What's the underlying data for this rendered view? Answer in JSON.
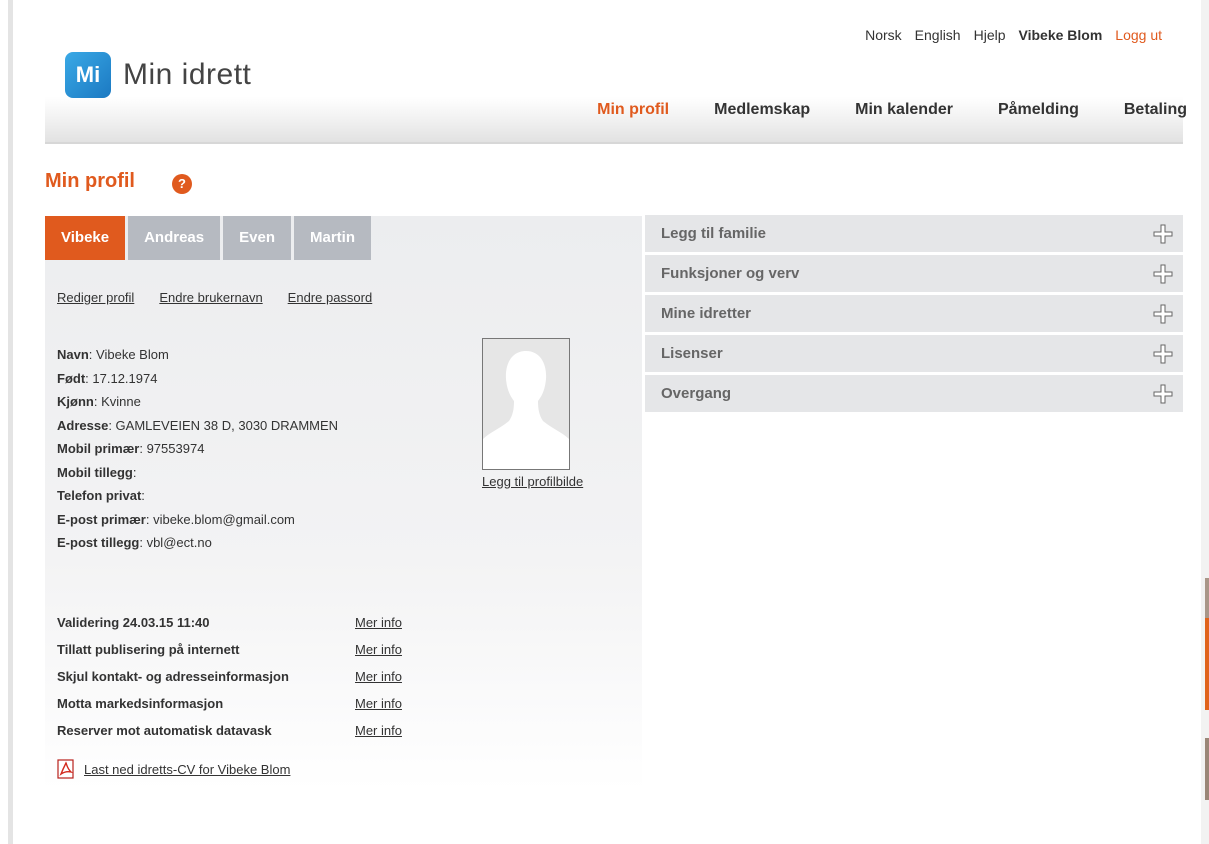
{
  "topnav": {
    "norsk": "Norsk",
    "english": "English",
    "help": "Hjelp",
    "user": "Vibeke Blom",
    "logout": "Logg ut"
  },
  "logo": {
    "badge": "Mi",
    "text": "Min idrett"
  },
  "mainnav": [
    "Min profil",
    "Medlemskap",
    "Min kalender",
    "Påmelding",
    "Betaling"
  ],
  "page": {
    "title": "Min profil",
    "help_icon": "?"
  },
  "tabs": [
    "Vibeke",
    "Andreas",
    "Even",
    "Martin"
  ],
  "actions": [
    "Rediger profil",
    "Endre brukernavn",
    "Endre passord"
  ],
  "profile": [
    {
      "label": "Navn",
      "value": " Vibeke Blom"
    },
    {
      "label": "Født",
      "value": " 17.12.1974"
    },
    {
      "label": "Kjønn",
      "value": " Kvinne"
    },
    {
      "label": "Adresse",
      "value": " GAMLEVEIEN 38 D, 3030 DRAMMEN"
    },
    {
      "label": "Mobil primær",
      "value": " 97553974"
    },
    {
      "label": "Mobil tillegg",
      "value": ""
    },
    {
      "label": "Telefon privat",
      "value": ""
    },
    {
      "label": "E-post primær",
      "value": " vibeke.blom@gmail.com"
    },
    {
      "label": "E-post tillegg",
      "value": " vbl@ect.no"
    }
  ],
  "photo_link": "Legg til profilbilde",
  "consents": [
    {
      "label": "Validering 24.03.15 11:40",
      "link": "Mer info"
    },
    {
      "label": "Tillatt publisering på internett",
      "link": "Mer info"
    },
    {
      "label": "Skjul kontakt- og adresseinformasjon",
      "link": "Mer info"
    },
    {
      "label": "Motta markedsinformasjon",
      "link": "Mer info"
    },
    {
      "label": "Reserver mot automatisk datavask",
      "link": "Mer info"
    }
  ],
  "cv_link": "Last ned idretts-CV for Vibeke Blom",
  "accordion": [
    "Legg til familie",
    "Funksjoner og verv",
    "Mine idretter",
    "Lisenser",
    "Overgang"
  ],
  "colors": {
    "accent": "#e05a1e",
    "tab_inactive": "#b6bac1",
    "logo": "#1b79c2"
  },
  "icons": {
    "help": "question-circle-icon",
    "expand": "plus-icon",
    "pdf": "pdf-icon",
    "avatar": "silhouette-icon"
  }
}
